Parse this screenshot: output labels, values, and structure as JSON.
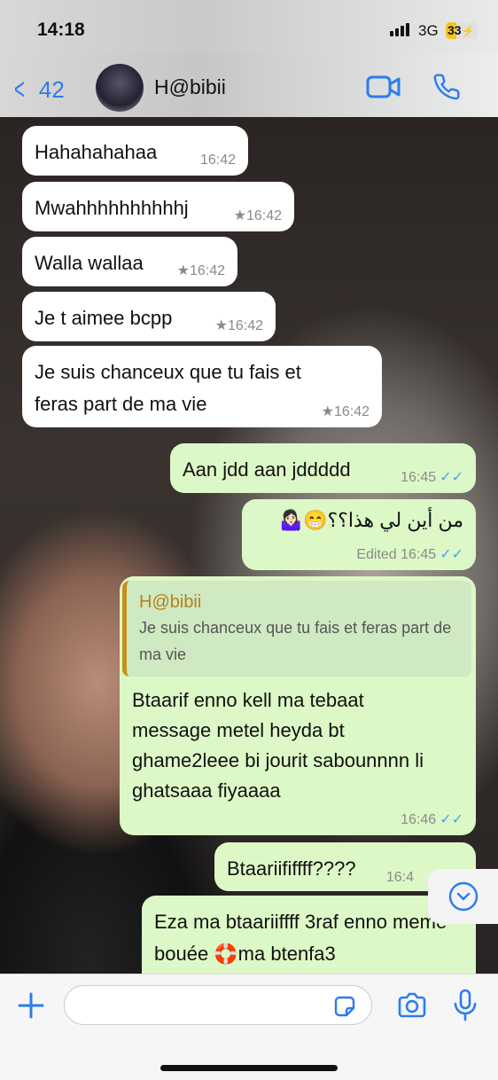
{
  "status": {
    "time": "14:18",
    "network": "3G",
    "battery": "33",
    "battery_level": 0.33
  },
  "header": {
    "back_count": "42",
    "contact_name": "H@bibii"
  },
  "accent": "#2b7cf0",
  "messages": [
    {
      "dir": "in",
      "text": "Hahahahahaa",
      "time": "16:42",
      "starred": false
    },
    {
      "dir": "in",
      "text": "Mwahhhhhhhhhhj",
      "time": "16:42",
      "starred": true
    },
    {
      "dir": "in",
      "text": "Walla wallaa",
      "time": "16:42",
      "starred": true
    },
    {
      "dir": "in",
      "text": "Je t aimee bcpp",
      "time": "16:42",
      "starred": true
    },
    {
      "dir": "in",
      "text": "Je suis chanceux que tu fais et feras part de ma vie",
      "time": "16:42",
      "starred": true
    },
    {
      "dir": "out",
      "text": "Aan jdd aan jddddd",
      "time": "16:45",
      "read": true
    },
    {
      "dir": "out",
      "text": "من أين لي هذا؟؟😁🤷🏻‍♀️",
      "time": "16:45",
      "edited_label": "Edited",
      "read": true
    },
    {
      "dir": "out",
      "quote_name": "H@bibii",
      "quote_text": "Je suis chanceux que tu fais et feras part de ma vie",
      "text": "Btaarif enno kell ma tebaat message metel heyda bt ghame2leee bi jourit sabounnnn li ghatsaaa fiyaaaa",
      "time": "16:46",
      "read": true
    },
    {
      "dir": "out",
      "text": "Btaariififfff????",
      "time": "16:4"
    },
    {
      "dir": "out",
      "text": "Eza ma btaariiffff 3raf enno meme bouée 🛟ma btenfa3"
    }
  ],
  "composer": {
    "placeholder": ""
  }
}
